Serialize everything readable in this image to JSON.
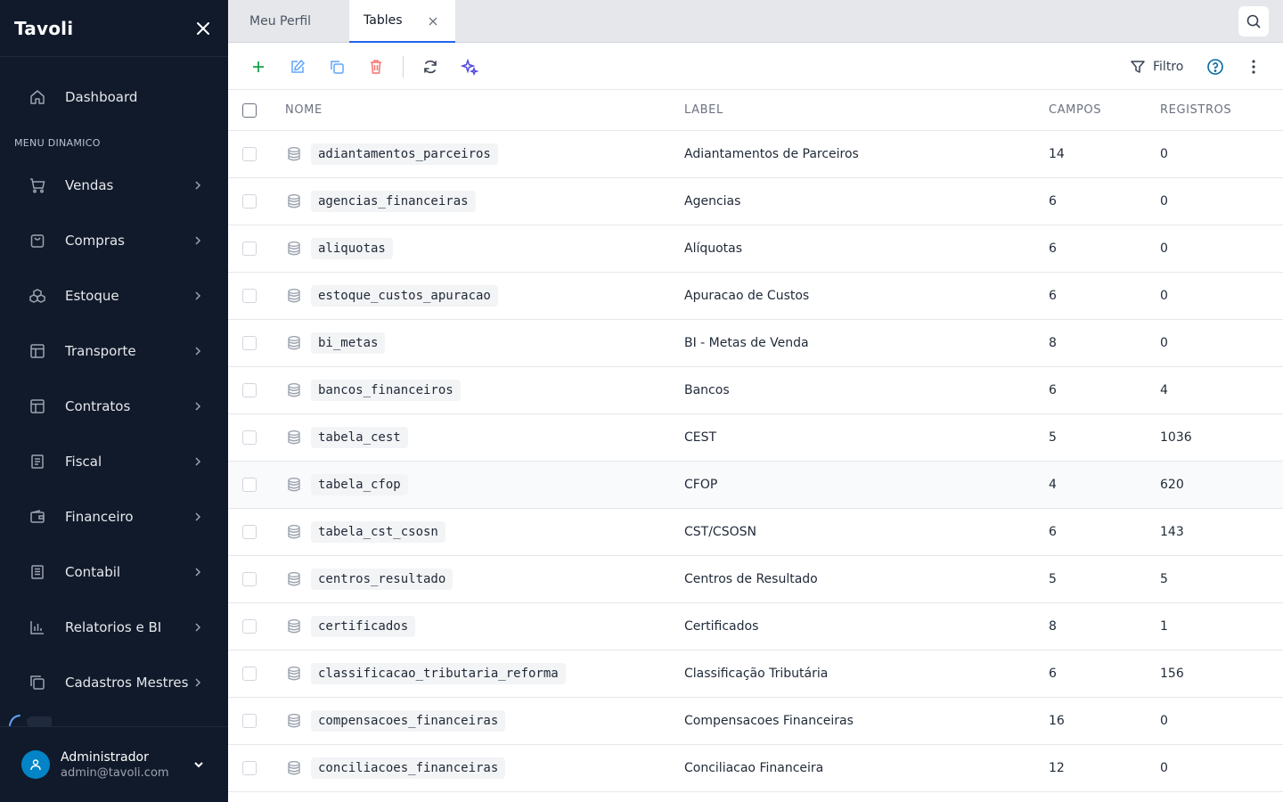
{
  "app": {
    "brand": "Tavoli"
  },
  "sidebar": {
    "dashboard_label": "Dashboard",
    "section_title": "MENU DINAMICO",
    "items": [
      {
        "label": "Vendas",
        "icon": "cart-icon"
      },
      {
        "label": "Compras",
        "icon": "bag-icon"
      },
      {
        "label": "Estoque",
        "icon": "boxes-icon"
      },
      {
        "label": "Transporte",
        "icon": "layout-icon"
      },
      {
        "label": "Contratos",
        "icon": "layout-icon"
      },
      {
        "label": "Fiscal",
        "icon": "receipt-icon"
      },
      {
        "label": "Financeiro",
        "icon": "wallet-icon"
      },
      {
        "label": "Contabil",
        "icon": "ledger-icon"
      },
      {
        "label": "Relatorios e BI",
        "icon": "bar-chart-icon"
      },
      {
        "label": "Cadastros Mestres",
        "icon": "copy-icon"
      }
    ]
  },
  "user": {
    "name": "Administrador",
    "email": "admin@tavoli.com"
  },
  "tabs": [
    {
      "label": "Meu Perfil"
    },
    {
      "label": "Tables"
    }
  ],
  "toolbar": {
    "filter_label": "Filtro"
  },
  "colors": {
    "sidebar_bg": "#111a2b",
    "accent": "#2563eb",
    "add": "#16a34a",
    "delete": "#ef4444"
  },
  "table": {
    "headers": {
      "nome": "NOME",
      "label": "LABEL",
      "campos": "CAMPOS",
      "registros": "REGISTROS"
    },
    "rows": [
      {
        "nome": "adiantamentos_parceiros",
        "label": "Adiantamentos de Parceiros",
        "campos": "14",
        "registros": "0"
      },
      {
        "nome": "agencias_financeiras",
        "label": "Agencias",
        "campos": "6",
        "registros": "0"
      },
      {
        "nome": "aliquotas",
        "label": "Alíquotas",
        "campos": "6",
        "registros": "0"
      },
      {
        "nome": "estoque_custos_apuracao",
        "label": "Apuracao de Custos",
        "campos": "6",
        "registros": "0"
      },
      {
        "nome": "bi_metas",
        "label": "BI - Metas de Venda",
        "campos": "8",
        "registros": "0"
      },
      {
        "nome": "bancos_financeiros",
        "label": "Bancos",
        "campos": "6",
        "registros": "4"
      },
      {
        "nome": "tabela_cest",
        "label": "CEST",
        "campos": "5",
        "registros": "1036"
      },
      {
        "nome": "tabela_cfop",
        "label": "CFOP",
        "campos": "4",
        "registros": "620"
      },
      {
        "nome": "tabela_cst_csosn",
        "label": "CST/CSOSN",
        "campos": "6",
        "registros": "143"
      },
      {
        "nome": "centros_resultado",
        "label": "Centros de Resultado",
        "campos": "5",
        "registros": "5"
      },
      {
        "nome": "certificados",
        "label": "Certificados",
        "campos": "8",
        "registros": "1"
      },
      {
        "nome": "classificacao_tributaria_reforma",
        "label": "Classificação Tributária",
        "campos": "6",
        "registros": "156"
      },
      {
        "nome": "compensacoes_financeiras",
        "label": "Compensacoes Financeiras",
        "campos": "16",
        "registros": "0"
      },
      {
        "nome": "conciliacoes_financeiras",
        "label": "Conciliacao Financeira",
        "campos": "12",
        "registros": "0"
      }
    ]
  }
}
